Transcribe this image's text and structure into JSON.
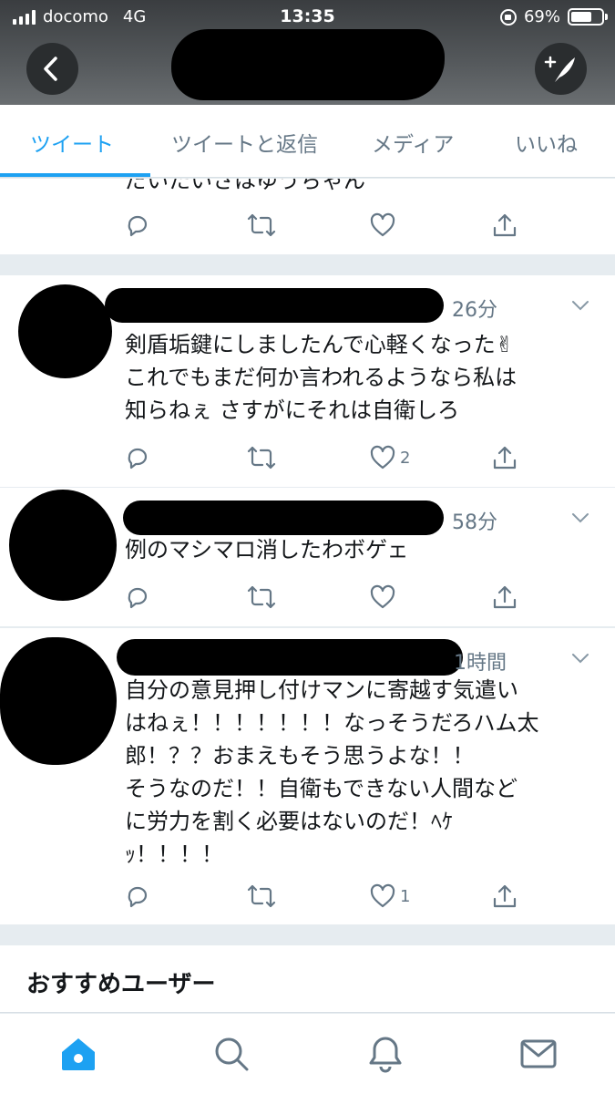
{
  "status_bar": {
    "carrier": "docomo",
    "network": "4G",
    "time": "13:35",
    "battery": "69%",
    "battery_level": 0.69
  },
  "tabs": [
    {
      "label": "ツイート",
      "active": true
    },
    {
      "label": "ツイートと返信",
      "active": false
    },
    {
      "label": "メディア",
      "active": false
    },
    {
      "label": "いいね",
      "active": false
    }
  ],
  "tweets": [
    {
      "text_lines": [
        "だいたいさはゆうちゃん"
      ],
      "time": "",
      "likes": ""
    },
    {
      "text_lines": [
        "剣盾垢鍵にしましたんで心軽くなった✌",
        "これでもまだ何か言われるようなら私は",
        "知らねぇ さすがにそれは自衛しろ"
      ],
      "time": "26分",
      "likes": "2"
    },
    {
      "text_lines": [
        "例のマシマロ消したわボゲェ"
      ],
      "time": "58分",
      "likes": ""
    },
    {
      "text_lines": [
        "自分の意見押し付けマンに寄越す気遣い",
        "はねぇ！！！！！！！なっそうだろハム太",
        "郎！？？おまえもそう思うよな！！",
        "そうなのだ！！自衛もできない人間など",
        "に労力を割く必要はないのだ！ﾍｹ",
        "ｯ！！！！"
      ],
      "time": "1時間",
      "likes": "1"
    }
  ],
  "recommended": {
    "title": "おすすめユーザー"
  },
  "colors": {
    "accent": "#1da1f2",
    "muted": "#657786",
    "divider": "#e6ecf0"
  },
  "icons": [
    "reply-icon",
    "retweet-icon",
    "like-icon",
    "share-icon",
    "home-icon",
    "search-icon",
    "notifications-icon",
    "messages-icon"
  ]
}
